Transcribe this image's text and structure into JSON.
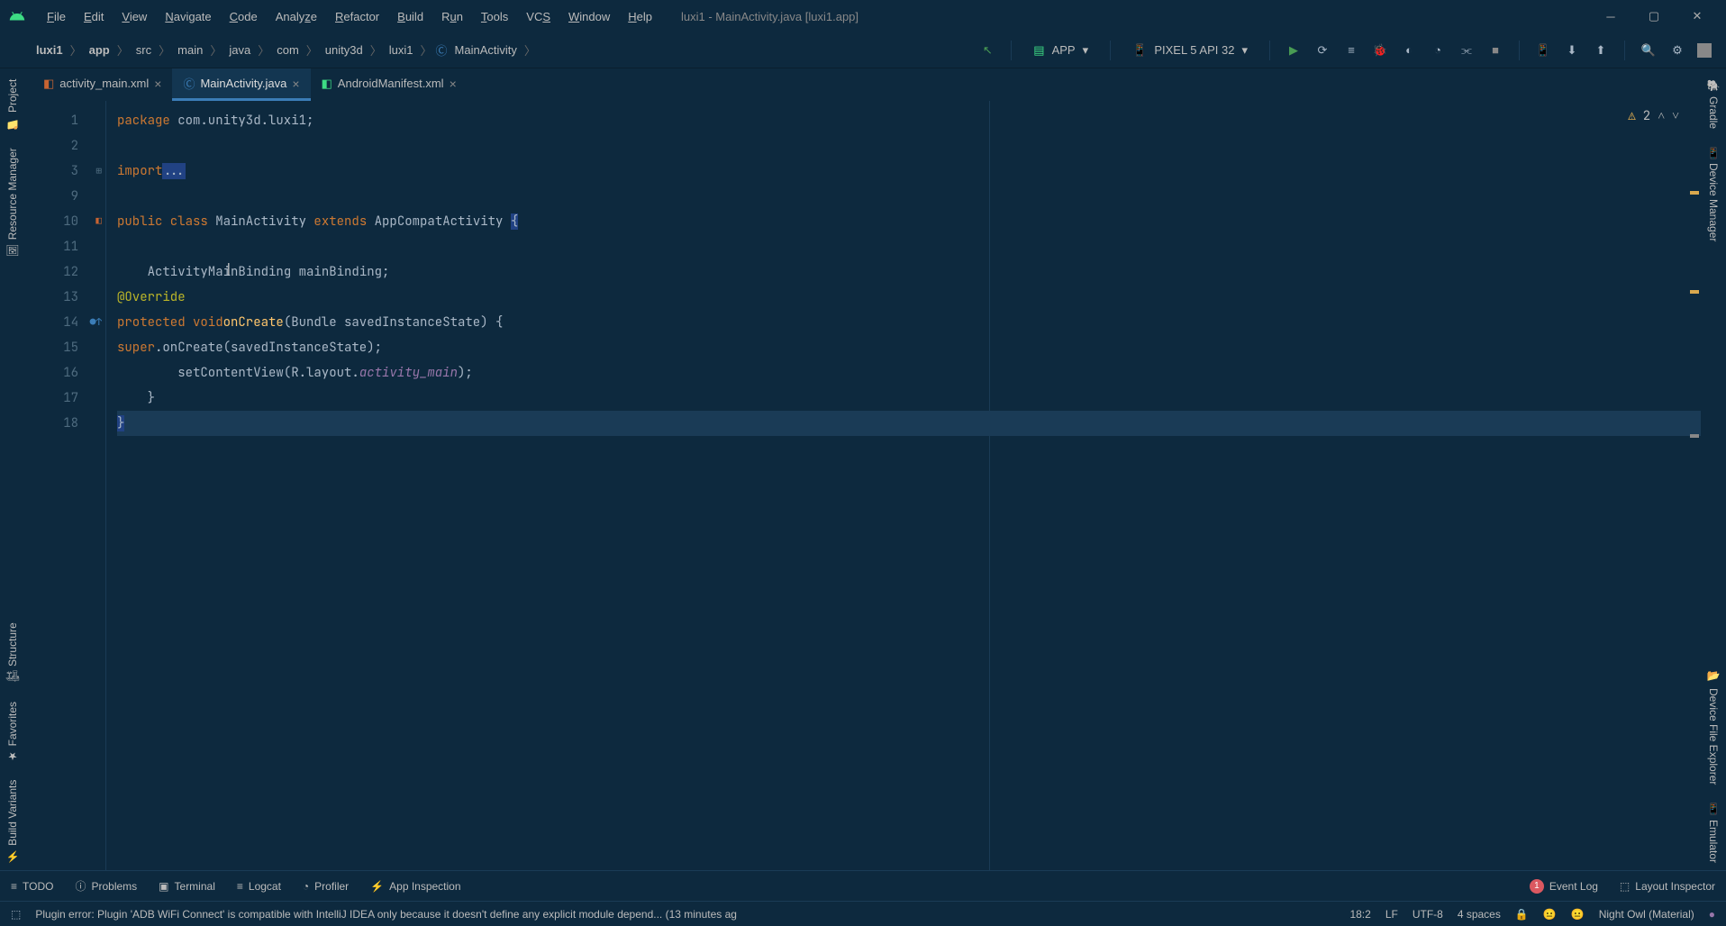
{
  "menu": {
    "items": [
      "File",
      "Edit",
      "View",
      "Navigate",
      "Code",
      "Analyze",
      "Refactor",
      "Build",
      "Run",
      "Tools",
      "VCS",
      "Window",
      "Help"
    ]
  },
  "title": "luxi1 - MainActivity.java [luxi1.app]",
  "breadcrumb": {
    "items": [
      "luxi1",
      "app",
      "src",
      "main",
      "java",
      "com",
      "unity3d",
      "luxi1",
      "MainActivity"
    ]
  },
  "run_config": {
    "app": "APP",
    "device": "PIXEL 5 API 32"
  },
  "tabs": [
    {
      "name": "activity_main.xml",
      "active": false
    },
    {
      "name": "MainActivity.java",
      "active": true
    },
    {
      "name": "AndroidManifest.xml",
      "active": false
    }
  ],
  "left_tabs": [
    "Project",
    "Resource Manager",
    "Structure",
    "Favorites",
    "Build Variants"
  ],
  "right_tabs": [
    "Gradle",
    "Device Manager",
    "Device File Explorer",
    "Emulator"
  ],
  "editor": {
    "lines": [
      {
        "num": 1,
        "text": "package com.unity3d.luxi1;"
      },
      {
        "num": 2,
        "text": ""
      },
      {
        "num": 3,
        "text": "import ..."
      },
      {
        "num": 9,
        "text": ""
      },
      {
        "num": 10,
        "text": "public class MainActivity extends AppCompatActivity {"
      },
      {
        "num": 11,
        "text": ""
      },
      {
        "num": 12,
        "text": "    ActivityMainBinding mainBinding;"
      },
      {
        "num": 13,
        "text": "    @Override"
      },
      {
        "num": 14,
        "text": "    protected void onCreate(Bundle savedInstanceState) {"
      },
      {
        "num": 15,
        "text": "        super.onCreate(savedInstanceState);"
      },
      {
        "num": 16,
        "text": "        setContentView(R.layout.activity_main);"
      },
      {
        "num": 17,
        "text": "    }"
      },
      {
        "num": 18,
        "text": "}"
      }
    ],
    "warning_count": "2"
  },
  "bottom_tools": {
    "left": [
      "TODO",
      "Problems",
      "Terminal",
      "Logcat",
      "Profiler",
      "App Inspection"
    ],
    "right": [
      "Event Log",
      "Layout Inspector"
    ],
    "event_count": "1"
  },
  "status": {
    "message": "Plugin error: Plugin 'ADB WiFi Connect' is compatible with IntelliJ IDEA only because it doesn't define any explicit module depend... (13 minutes ag",
    "position": "18:2",
    "line_sep": "LF",
    "encoding": "UTF-8",
    "indent": "4 spaces",
    "theme": "Night Owl (Material)"
  }
}
